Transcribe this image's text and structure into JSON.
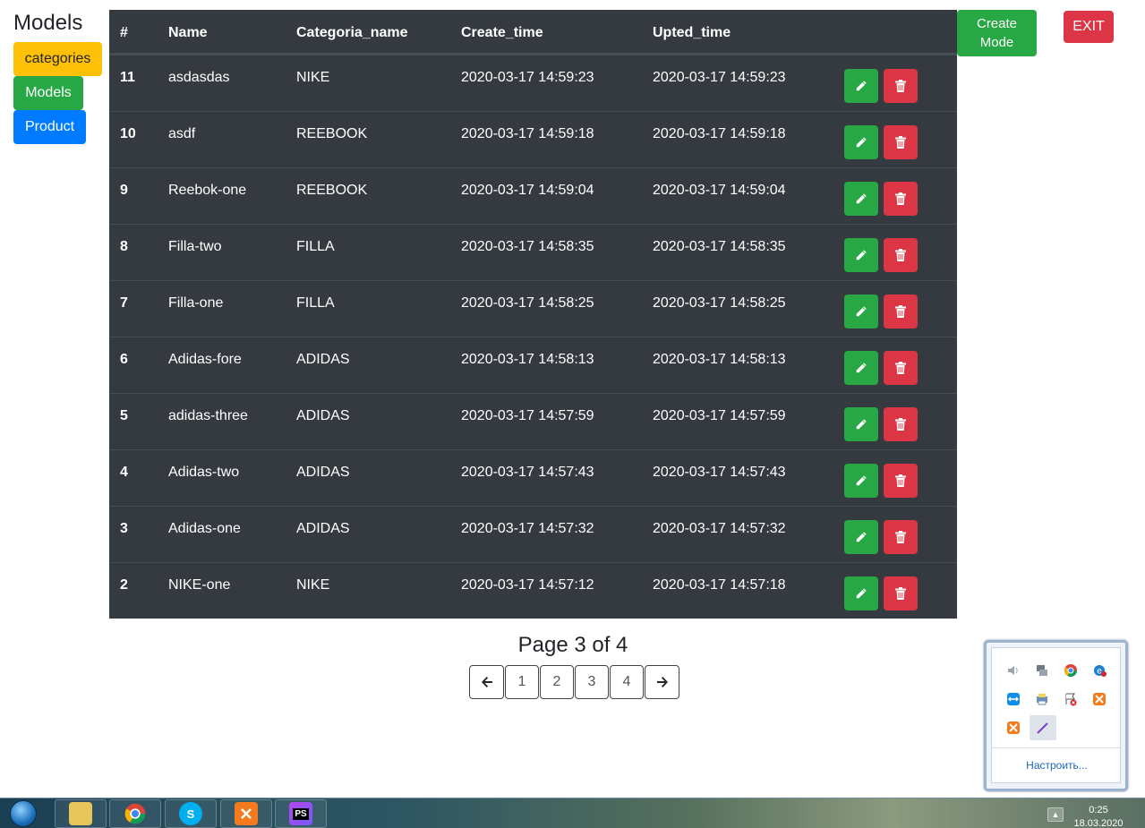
{
  "nav": {
    "title": "Models",
    "buttons": [
      "categories",
      "Models",
      "Product"
    ]
  },
  "table": {
    "headers": [
      "#",
      "Name",
      "Categoria_name",
      "Create_time",
      "Upted_time"
    ],
    "rows": [
      {
        "id": "11",
        "name": "asdasdas",
        "category": "NIKE",
        "created": "2020-03-17 14:59:23",
        "updated": "2020-03-17 14:59:23"
      },
      {
        "id": "10",
        "name": "asdf",
        "category": "REEBOOK",
        "created": "2020-03-17 14:59:18",
        "updated": "2020-03-17 14:59:18"
      },
      {
        "id": "9",
        "name": "Reebok-one",
        "category": "REEBOOK",
        "created": "2020-03-17 14:59:04",
        "updated": "2020-03-17 14:59:04"
      },
      {
        "id": "8",
        "name": "Filla-two",
        "category": "FILLA",
        "created": "2020-03-17 14:58:35",
        "updated": "2020-03-17 14:58:35"
      },
      {
        "id": "7",
        "name": "Filla-one",
        "category": "FILLA",
        "created": "2020-03-17 14:58:25",
        "updated": "2020-03-17 14:58:25"
      },
      {
        "id": "6",
        "name": "Adidas-fore",
        "category": "ADIDAS",
        "created": "2020-03-17 14:58:13",
        "updated": "2020-03-17 14:58:13"
      },
      {
        "id": "5",
        "name": "adidas-three",
        "category": "ADIDAS",
        "created": "2020-03-17 14:57:59",
        "updated": "2020-03-17 14:57:59"
      },
      {
        "id": "4",
        "name": "Adidas-two",
        "category": "ADIDAS",
        "created": "2020-03-17 14:57:43",
        "updated": "2020-03-17 14:57:43"
      },
      {
        "id": "3",
        "name": "Adidas-one",
        "category": "ADIDAS",
        "created": "2020-03-17 14:57:32",
        "updated": "2020-03-17 14:57:32"
      },
      {
        "id": "2",
        "name": "NIKE-one",
        "category": "NIKE",
        "created": "2020-03-17 14:57:12",
        "updated": "2020-03-17 14:57:18"
      }
    ],
    "row_actions": {
      "edit_icon": "pencil-icon",
      "delete_icon": "trash-icon"
    }
  },
  "header_actions": {
    "create_line1": "Create",
    "create_line2": "Mode",
    "exit_label": "EXIT"
  },
  "pagination": {
    "info": "Page 3 of 4",
    "pages": [
      "1",
      "2",
      "3",
      "4"
    ],
    "prev_icon": "arrow-left-icon",
    "next_icon": "arrow-right-icon"
  },
  "tray_popup": {
    "customize_link": "Настроить...",
    "icons": [
      "volume-icon",
      "network-icon",
      "chrome-icon",
      "ie-icon",
      "teamviewer-icon",
      "printer-icon",
      "action-center-icon",
      "xampp-icon",
      "xampp-icon",
      "pen-icon"
    ]
  },
  "taskbar": {
    "apps": [
      "explorer-icon",
      "chrome-icon",
      "skype-icon",
      "xampp-icon",
      "phpstorm-icon"
    ],
    "time": "0:25",
    "date": "18.03.2020"
  },
  "colors": {
    "table_bg": "#343a40",
    "success": "#28a745",
    "danger": "#dc3545",
    "warning": "#ffc107",
    "primary": "#007bff"
  }
}
